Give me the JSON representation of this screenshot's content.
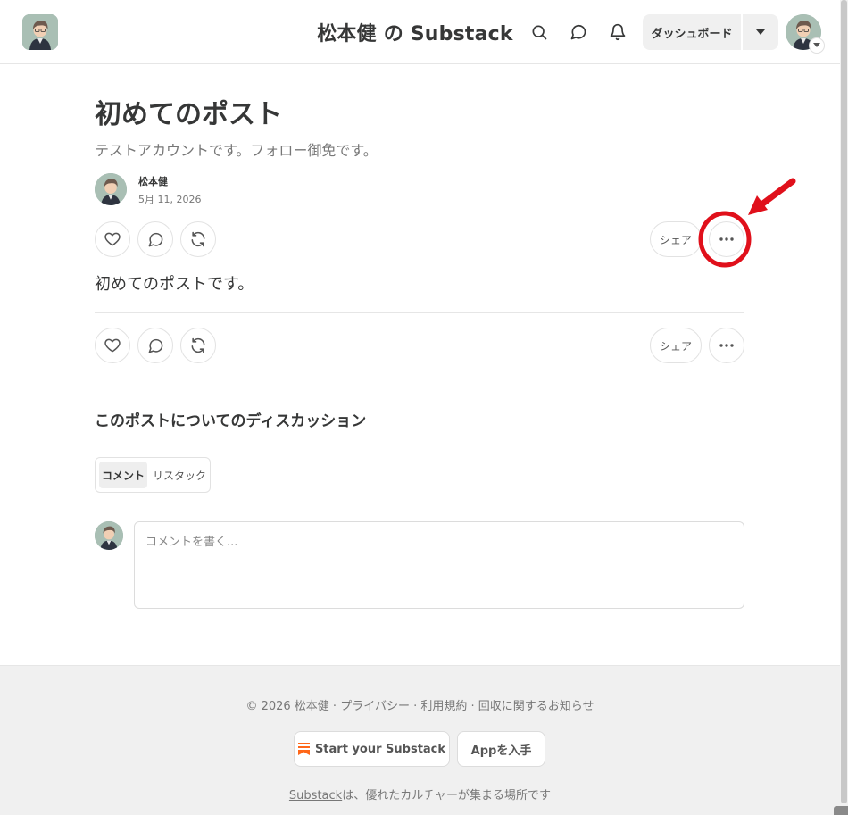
{
  "header": {
    "publication_title": "松本健 の Substack",
    "dashboard_label": "ダッシュボード",
    "icons": [
      "search-icon",
      "chat-bubble-icon",
      "bell-icon",
      "caret-down-icon"
    ]
  },
  "post": {
    "title": "初めてのポスト",
    "subtitle": "テストアカウントです。フォロー御免です。",
    "author": "松本健",
    "date": "5月 11, 2026",
    "body": "初めてのポストです。",
    "share_label": "シェア"
  },
  "discussion": {
    "title": "このポストについてのディスカッション",
    "tabs": [
      {
        "label": "コメント",
        "active": true
      },
      {
        "label": "リスタック",
        "active": false
      }
    ],
    "comment_placeholder": "コメントを書く..."
  },
  "footer": {
    "copyright": "© 2026 松本健 · ",
    "links": [
      "プライバシー",
      "利用規約",
      "回収に関するお知らせ"
    ],
    "separator": " · ",
    "start_button": "Start your Substack",
    "app_button": "Appを入手",
    "tagline_link": "Substack",
    "tagline_rest": "は、優れたカルチャーが集まる場所です"
  },
  "colors": {
    "accent_orange": "#ff6719",
    "annotation_red": "#e0101b",
    "text": "#363737",
    "muted": "#777777"
  }
}
